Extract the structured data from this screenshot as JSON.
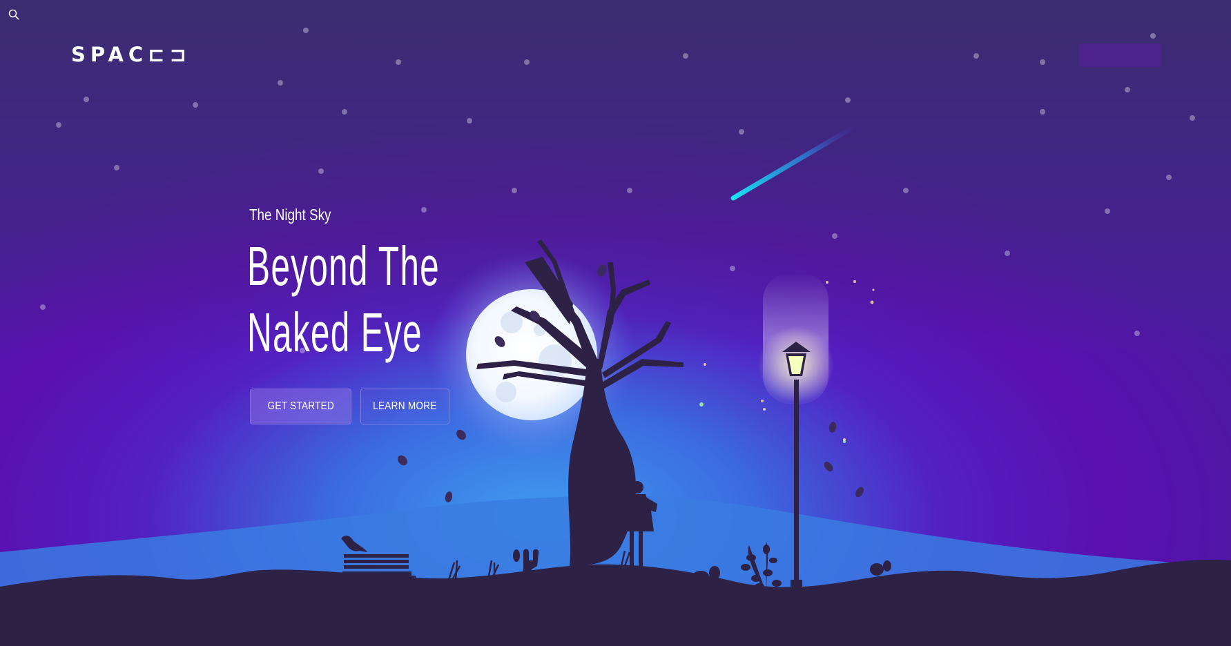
{
  "header": {
    "logo_text": "SPAC",
    "logo_tail": "⊏⊐",
    "search_icon": "search-icon"
  },
  "hero": {
    "eyebrow": "The Night Sky",
    "headline_line1": "Beyond The",
    "headline_line2": "Naked Eye",
    "primary_button": "GET STARTED",
    "secondary_button": "LEARN MORE"
  },
  "colors": {
    "sky_top": "#3c2a72",
    "sky_mid": "#5a0fb0",
    "glow": "#3d8de8",
    "ground": "#2e2248",
    "moon": "#eef6ff",
    "meteor": "#19d9f0"
  }
}
